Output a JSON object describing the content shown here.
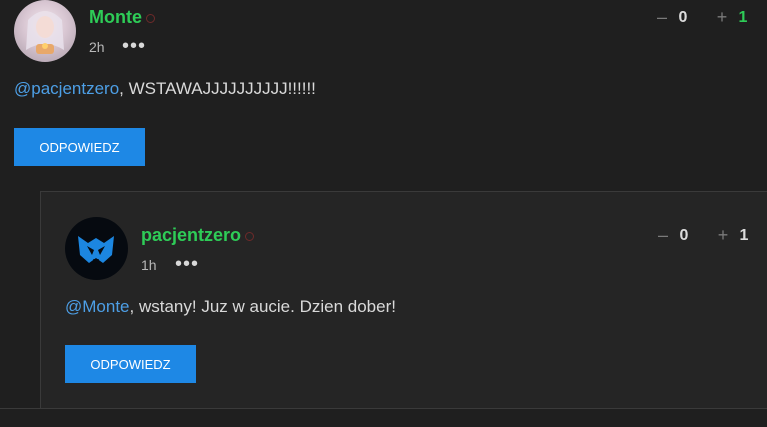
{
  "comments": [
    {
      "username": "Monte",
      "time": "2h",
      "more": "•••",
      "votes": {
        "minus": "–",
        "down": "0",
        "plus": "+",
        "up": "1"
      },
      "mention": "@pacjentzero",
      "text": ", WSTAWAJJJJJJJJJJ!!!!!!",
      "reply": "ODPOWIEDZ"
    },
    {
      "username": "pacjentzero",
      "time": "1h",
      "more": "•••",
      "votes": {
        "minus": "–",
        "down": "0",
        "plus": "+",
        "up": "1"
      },
      "mention": "@Monte",
      "text": ", wstany! Juz w aucie. Dzien dober!",
      "reply": "ODPOWIEDZ"
    }
  ],
  "colors": {
    "accent": "#1e88e5",
    "username": "#2ecc57",
    "mention": "#4d9fe6",
    "background": "#1f1f1f"
  }
}
